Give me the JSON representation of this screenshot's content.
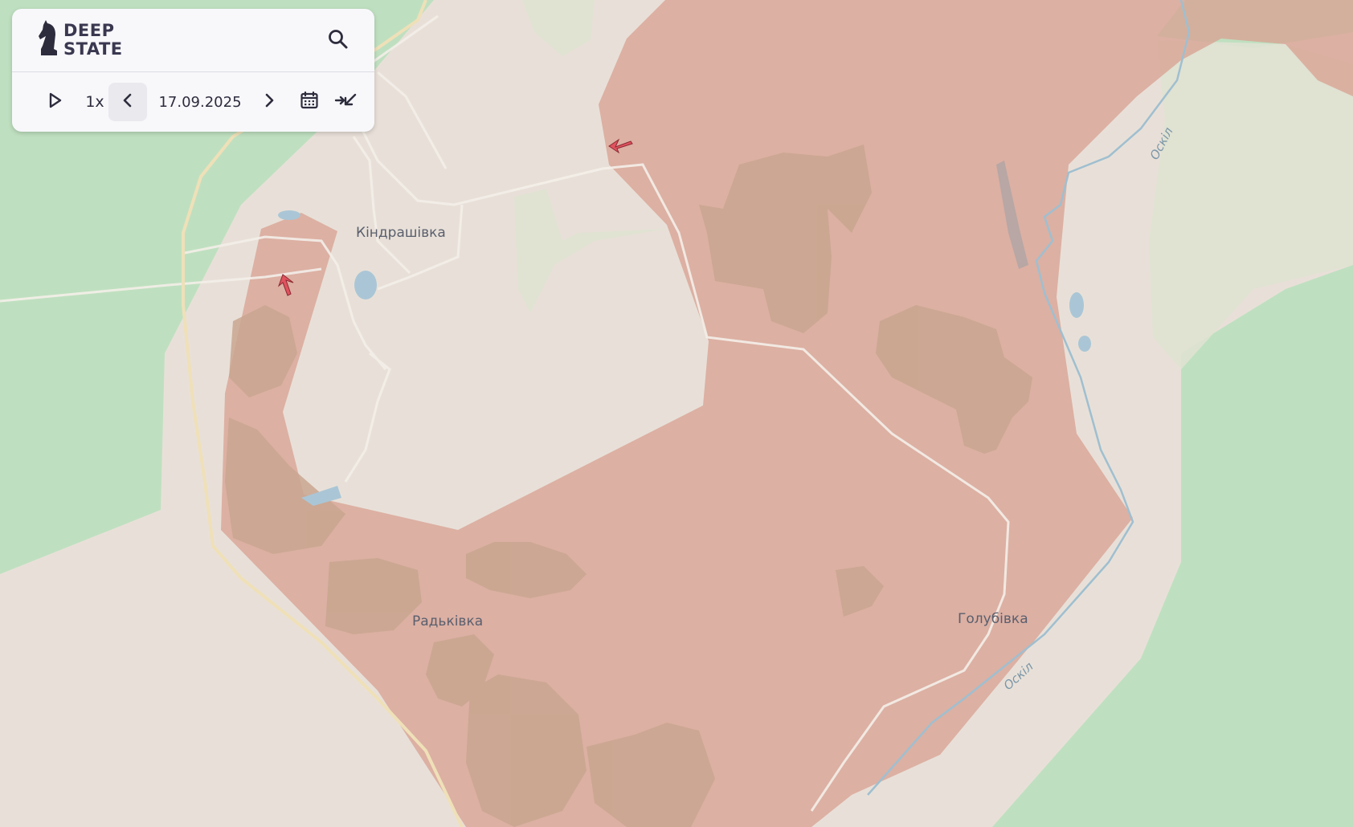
{
  "app": {
    "logo_line1": "DEEP",
    "logo_line2": "STATE"
  },
  "timeline": {
    "speed": "1x",
    "date": "17.09.2025"
  },
  "map": {
    "places": [
      {
        "name": "Кіндрашівка"
      },
      {
        "name": "Радьківка"
      },
      {
        "name": "Голубівка"
      }
    ],
    "rivers": [
      {
        "name": "Оскіл"
      },
      {
        "name": "Оскіл"
      }
    ],
    "colors": {
      "occupied": "#d9a394",
      "land": "#e8e0d8",
      "forest": "#bfe0c0",
      "water": "#aac6d6",
      "arrow": "#e0525e"
    }
  },
  "icons": {
    "logo": "knight-chess-icon",
    "search": "search-icon",
    "play": "play-icon",
    "prev": "chevron-left-icon",
    "next": "chevron-right-icon",
    "calendar": "calendar-icon",
    "collapse": "collapse-arrows-icon",
    "attack": "attack-arrow-icon"
  }
}
